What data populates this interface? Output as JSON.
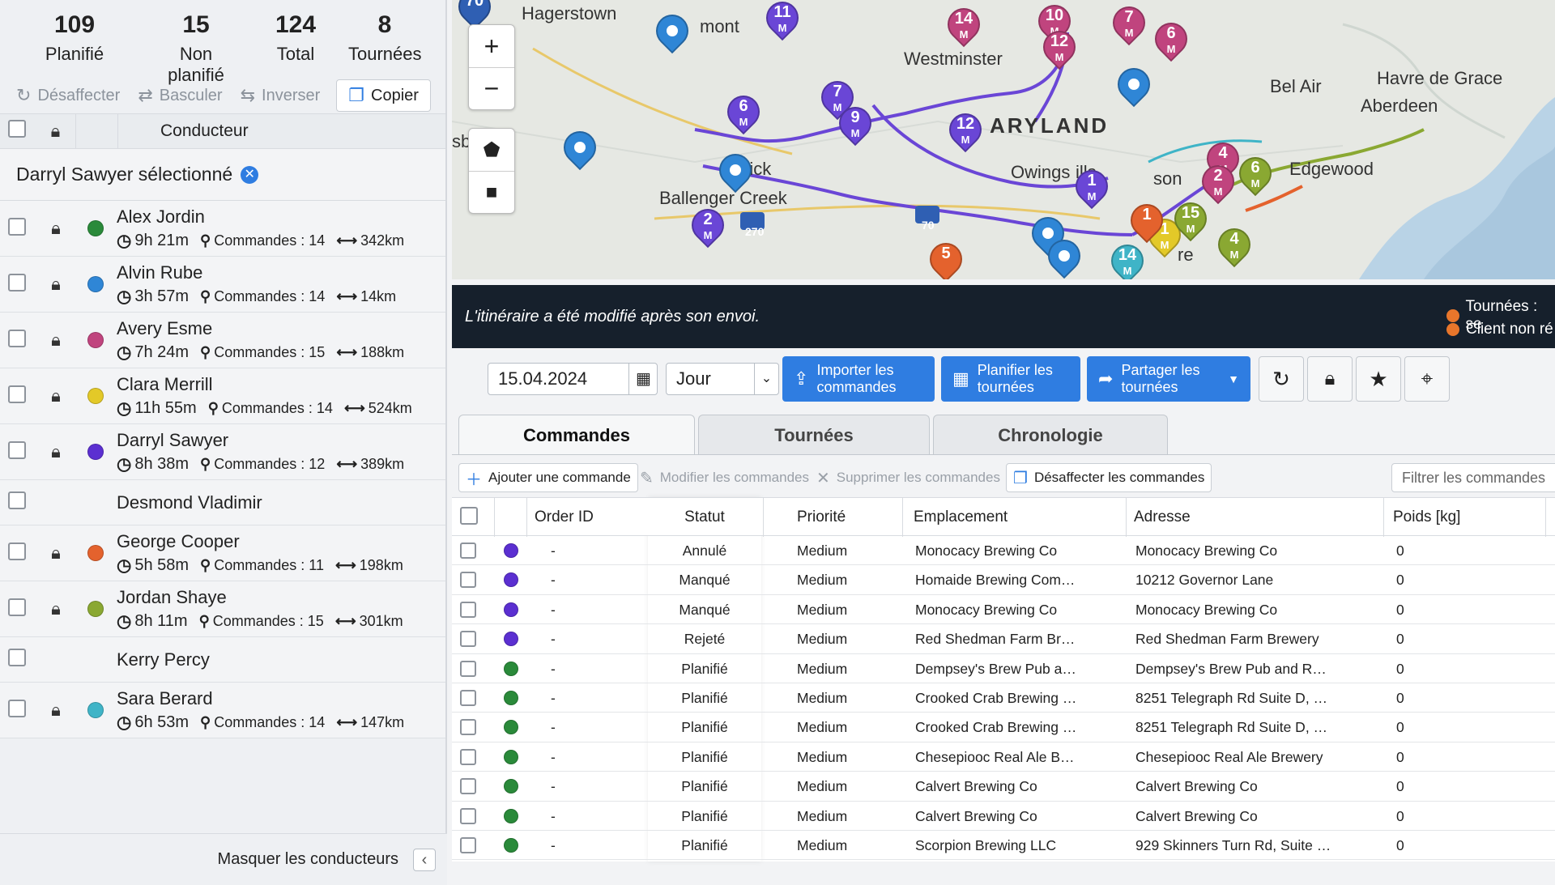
{
  "stats": [
    {
      "value": "109",
      "label": "Planifié"
    },
    {
      "value": "15",
      "label": "Non planifié"
    },
    {
      "value": "124",
      "label": "Total"
    },
    {
      "value": "8",
      "label": "Tournées"
    }
  ],
  "driver_actions": {
    "unassign": "Désaffecter",
    "switch": "Basculer",
    "invert": "Inverser",
    "copy": "Copier"
  },
  "driver_header": "Conducteur",
  "selected_driver": "Darryl Sawyer sélectionné",
  "drivers": [
    {
      "name": "Alex Jordin",
      "time": "9h 21m",
      "orders": "Commandes : 14",
      "dist": "342km",
      "color": "#2a8a3a",
      "locked": true
    },
    {
      "name": "Alvin Rube",
      "time": "3h 57m",
      "orders": "Commandes : 14",
      "dist": "14km",
      "color": "#2f86d6",
      "locked": true
    },
    {
      "name": "Avery Esme",
      "time": "7h 24m",
      "orders": "Commandes : 15",
      "dist": "188km",
      "color": "#c0447e",
      "locked": true
    },
    {
      "name": "Clara Merrill",
      "time": "11h 55m",
      "orders": "Commandes : 14",
      "dist": "524km",
      "color": "#e3c928",
      "locked": true
    },
    {
      "name": "Darryl Sawyer",
      "time": "8h 38m",
      "orders": "Commandes : 12",
      "dist": "389km",
      "color": "#5b2fd1",
      "locked": true
    },
    {
      "name": "Desmond Vladimir",
      "time": "",
      "orders": "",
      "dist": "",
      "color": "",
      "locked": false
    },
    {
      "name": "George Cooper",
      "time": "5h 58m",
      "orders": "Commandes : 11",
      "dist": "198km",
      "color": "#e4622d",
      "locked": true
    },
    {
      "name": "Jordan Shaye",
      "time": "8h 11m",
      "orders": "Commandes : 15",
      "dist": "301km",
      "color": "#8aa832",
      "locked": true
    },
    {
      "name": "Kerry Percy",
      "time": "",
      "orders": "",
      "dist": "",
      "color": "",
      "locked": false
    },
    {
      "name": "Sara Berard",
      "time": "6h 53m",
      "orders": "Commandes : 14",
      "dist": "147km",
      "color": "#3fb4c7",
      "locked": true
    }
  ],
  "hide_drivers": "Masquer les conducteurs",
  "map": {
    "labels": [
      "Hagerstown",
      "mont",
      "Westminster",
      "ARYLAND",
      "Bel Air",
      "Havre de Grace",
      "Aberdeen",
      "Edgewood",
      "Owings",
      "ills",
      "rick",
      "Ballenger Creek",
      "son",
      "re",
      "sbi",
      "270",
      "70"
    ],
    "zoom_in": "+",
    "zoom_out": "−",
    "pins": [
      {
        "t": "70"
      },
      {
        "t": ""
      },
      {
        "t": "11",
        "m": "M"
      },
      {
        "t": "14",
        "m": "M"
      },
      {
        "t": "10",
        "m": "M"
      },
      {
        "t": "12",
        "m": "M"
      },
      {
        "t": "7",
        "m": "M"
      },
      {
        "t": "6",
        "m": "M"
      },
      {
        "t": "6",
        "m": "M"
      },
      {
        "t": "7",
        "m": "M"
      },
      {
        "t": "9",
        "m": "M"
      },
      {
        "t": "12",
        "m": "M"
      },
      {
        "t": ""
      },
      {
        "t": ""
      },
      {
        "t": ""
      },
      {
        "t": "2",
        "m": "M"
      },
      {
        "t": "1",
        "m": "M"
      },
      {
        "t": "4",
        "m": "M"
      },
      {
        "t": "2",
        "m": "M"
      },
      {
        "t": "6",
        "m": "M"
      },
      {
        "t": ""
      },
      {
        "t": "5"
      },
      {
        "t": ""
      },
      {
        "t": "14",
        "m": "M"
      },
      {
        "t": "1",
        "m": "M"
      },
      {
        "t": "15",
        "m": "M"
      },
      {
        "t": "4",
        "m": "M"
      },
      {
        "t": "1"
      }
    ]
  },
  "banner": {
    "message": "L'itinéraire a été modifié après son envoi.",
    "legend1": "Tournées : se",
    "legend2": "Client non ré",
    "legend_color": "#e8762b"
  },
  "toolbar": {
    "date": "15.04.2024",
    "period": "Jour",
    "import": "Importer les commandes",
    "plan": "Planifier les tournées",
    "share": "Partager les tournées"
  },
  "tabs": [
    "Commandes",
    "Tournées",
    "Chronologie"
  ],
  "subtoolbar": {
    "add": "Ajouter une commande",
    "edit": "Modifier les commandes",
    "delete": "Supprimer les commandes",
    "unassign": "Désaffecter les commandes",
    "filter_placeholder": "Filtrer les commandes"
  },
  "table": {
    "headers": [
      "Order ID",
      "Statut",
      "Priorité",
      "Emplacement",
      "Adresse",
      "Poids [kg]"
    ],
    "rows": [
      {
        "color": "#5b2fd1",
        "id": "-",
        "status": "Annulé",
        "priority": "Medium",
        "location": "Monocacy Brewing Co",
        "address": "Monocacy Brewing Co",
        "weight": "0"
      },
      {
        "color": "#5b2fd1",
        "id": "-",
        "status": "Manqué",
        "priority": "Medium",
        "location": "Homaide Brewing Com…",
        "address": "10212 Governor Lane",
        "weight": "0"
      },
      {
        "color": "#5b2fd1",
        "id": "-",
        "status": "Manqué",
        "priority": "Medium",
        "location": "Monocacy Brewing Co",
        "address": "Monocacy Brewing Co",
        "weight": "0"
      },
      {
        "color": "#5b2fd1",
        "id": "-",
        "status": "Rejeté",
        "priority": "Medium",
        "location": "Red Shedman Farm Br…",
        "address": "Red Shedman Farm Brewery",
        "weight": "0"
      },
      {
        "color": "#2a8a3a",
        "id": "-",
        "status": "Planifié",
        "priority": "Medium",
        "location": "Dempsey's Brew Pub a…",
        "address": "Dempsey's Brew Pub and R…",
        "weight": "0"
      },
      {
        "color": "#2a8a3a",
        "id": "-",
        "status": "Planifié",
        "priority": "Medium",
        "location": "Crooked Crab Brewing …",
        "address": "8251 Telegraph Rd Suite D, …",
        "weight": "0"
      },
      {
        "color": "#2a8a3a",
        "id": "-",
        "status": "Planifié",
        "priority": "Medium",
        "location": "Crooked Crab Brewing …",
        "address": "8251 Telegraph Rd Suite D, …",
        "weight": "0"
      },
      {
        "color": "#2a8a3a",
        "id": "-",
        "status": "Planifié",
        "priority": "Medium",
        "location": "Chesepiooc Real Ale B…",
        "address": "Chesepiooc Real Ale Brewery",
        "weight": "0"
      },
      {
        "color": "#2a8a3a",
        "id": "-",
        "status": "Planifié",
        "priority": "Medium",
        "location": "Calvert Brewing Co",
        "address": "Calvert Brewing Co",
        "weight": "0"
      },
      {
        "color": "#2a8a3a",
        "id": "-",
        "status": "Planifié",
        "priority": "Medium",
        "location": "Calvert Brewing Co",
        "address": "Calvert Brewing Co",
        "weight": "0"
      },
      {
        "color": "#2a8a3a",
        "id": "-",
        "status": "Planifié",
        "priority": "Medium",
        "location": "Scorpion Brewing LLC",
        "address": "929 Skinners Turn Rd, Suite …",
        "weight": "0"
      }
    ]
  }
}
